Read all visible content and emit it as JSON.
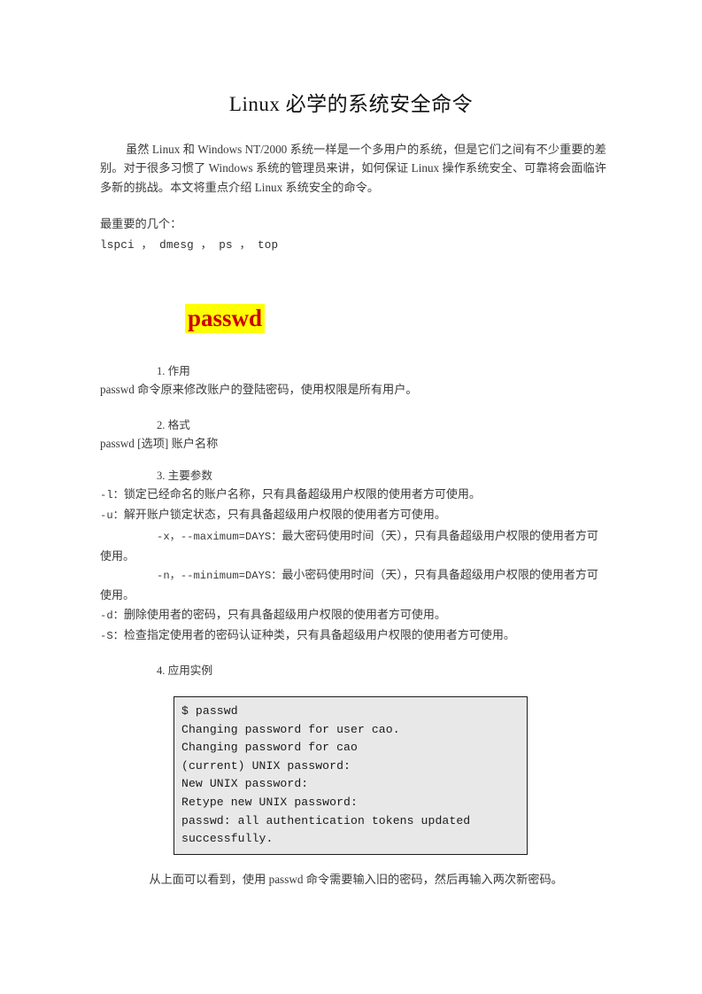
{
  "document": {
    "title": "Linux 必学的系统安全命令",
    "intro_paragraph": "虽然 Linux 和 Windows NT/2000 系统一样是一个多用户的系统，但是它们之间有不少重要的差别。对于很多习惯了 Windows 系统的管理员来讲，如何保证 Linux 操作系统安全、可靠将会面临许多新的挑战。本文将重点介绍 Linux 系统安全的命令。",
    "important_label": "最重要的几个：",
    "important_commands": "lspci ， dmesg ， ps ， top",
    "command_heading": "passwd",
    "sections": [
      {
        "heading": "1. 作用",
        "body": "passwd 命令原来修改账户的登陆密码，使用权限是所有用户。"
      },
      {
        "heading": "2. 格式",
        "body": "passwd [选项] 账户名称"
      },
      {
        "heading": "3. 主要参数",
        "body": ""
      },
      {
        "heading": "4. 应用实例",
        "body": ""
      }
    ],
    "parameters": [
      {
        "flag": "-l：",
        "desc": "锁定已经命名的账户名称，只有具备超级用户权限的使用者方可使用。"
      },
      {
        "flag": "-u：",
        "desc": "解开账户锁定状态，只有具备超级用户权限的使用者方可使用。"
      },
      {
        "flag": "-x，--maximum=DAYS：",
        "desc": "最大密码使用时间（天），只有具备超级用户权限的使用者方可使用。"
      },
      {
        "flag": "-n，--minimum=DAYS：",
        "desc": "最小密码使用时间（天），只有具备超级用户权限的使用者方可使用。"
      },
      {
        "flag": "-d：",
        "desc": "删除使用者的密码，只有具备超级用户权限的使用者方可使用。"
      },
      {
        "flag": "-S：",
        "desc": "检查指定使用者的密码认证种类，只有具备超级用户权限的使用者方可使用。"
      }
    ],
    "terminal_output": "$ passwd\nChanging password for user cao.\nChanging password for cao\n(current) UNIX password:\nNew UNIX password:\nRetype new UNIX password:\npasswd: all authentication tokens updated\nsuccessfully.",
    "closing_paragraph": "从上面可以看到，使用 passwd 命令需要输入旧的密码，然后再输入两次新密码。"
  },
  "colors": {
    "highlight_background": "#ffff00",
    "highlight_text": "#cc0000",
    "code_background": "#e8e8e8",
    "code_border": "#1d1d1d",
    "body_text": "#3a3a3a",
    "page_background": "#ffffff"
  }
}
